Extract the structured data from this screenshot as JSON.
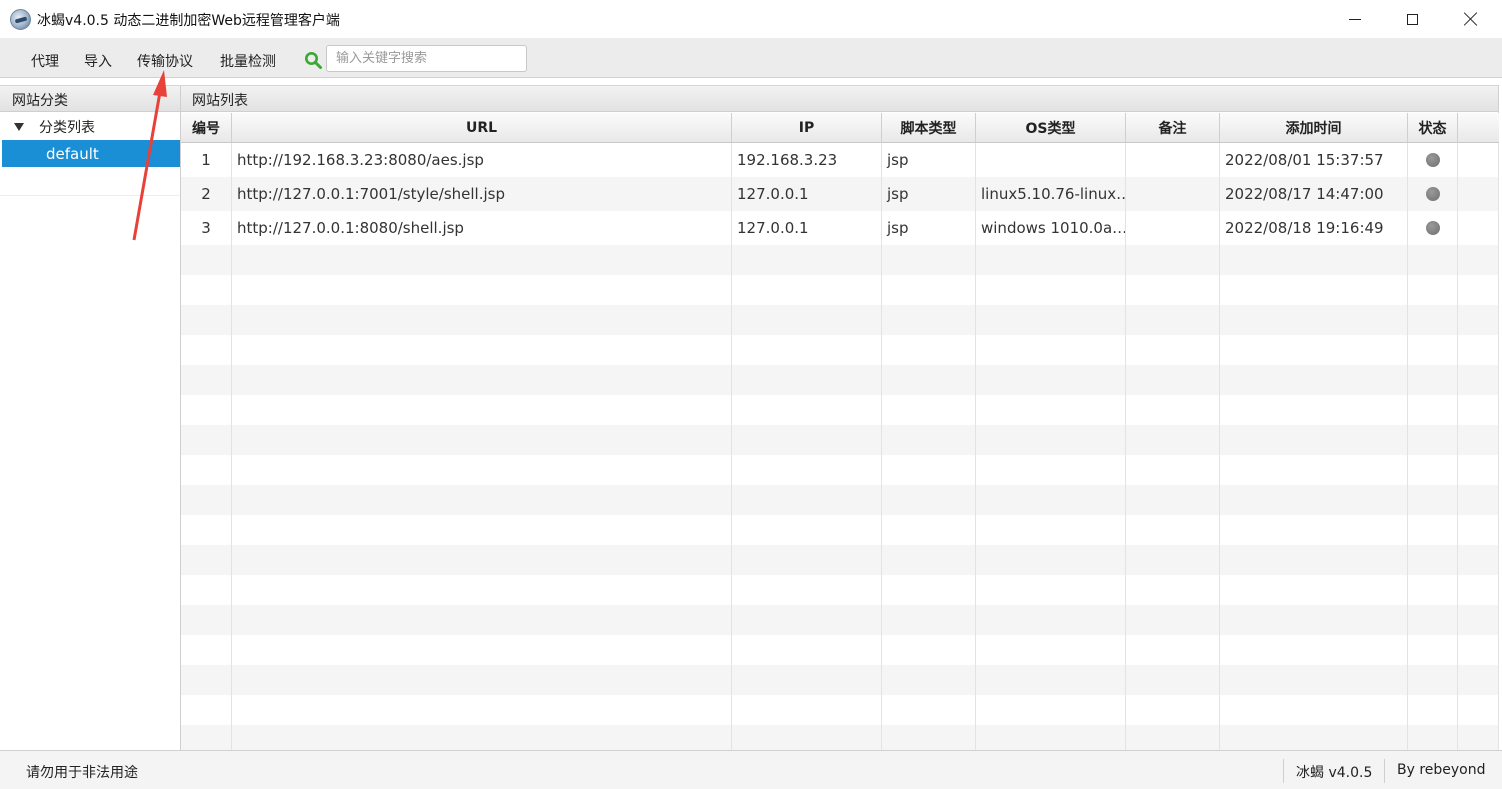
{
  "window": {
    "title": "冰蝎v4.0.5 动态二进制加密Web远程管理客户端"
  },
  "menu": {
    "items": [
      "代理",
      "导入",
      "传输协议",
      "批量检测"
    ]
  },
  "search": {
    "placeholder": "输入关键字搜索",
    "value": ""
  },
  "left_panel": {
    "header": "网站分类",
    "tree_root": "分类列表",
    "tree_selected": "default"
  },
  "right_panel": {
    "header": "网站列表"
  },
  "table": {
    "columns": [
      "编号",
      "URL",
      "IP",
      "脚本类型",
      "OS类型",
      "备注",
      "添加时间",
      "状态"
    ],
    "rows": [
      {
        "id": "1",
        "url": "http://192.168.3.23:8080/aes.jsp",
        "ip": "192.168.3.23",
        "script": "jsp",
        "os": "",
        "note": "",
        "added": "2022/08/01 15:37:57",
        "status": "offline"
      },
      {
        "id": "2",
        "url": "http://127.0.0.1:7001/style/shell.jsp",
        "ip": "127.0.0.1",
        "script": "jsp",
        "os": "linux5.10.76-linux…",
        "note": "",
        "added": "2022/08/17 14:47:00",
        "status": "offline"
      },
      {
        "id": "3",
        "url": "http://127.0.0.1:8080/shell.jsp",
        "ip": "127.0.0.1",
        "script": "jsp",
        "os": "windows 1010.0a…",
        "note": "",
        "added": "2022/08/18 19:16:49",
        "status": "offline"
      }
    ]
  },
  "statusbar": {
    "left": "请勿用于非法用途",
    "version": "冰蝎 v4.0.5",
    "author": "By rebeyond"
  },
  "colors": {
    "selection": "#1a8fd6",
    "search_icon": "#3aa832",
    "annotation_arrow": "#e8413a",
    "status_dot": "#7a7a7a"
  }
}
